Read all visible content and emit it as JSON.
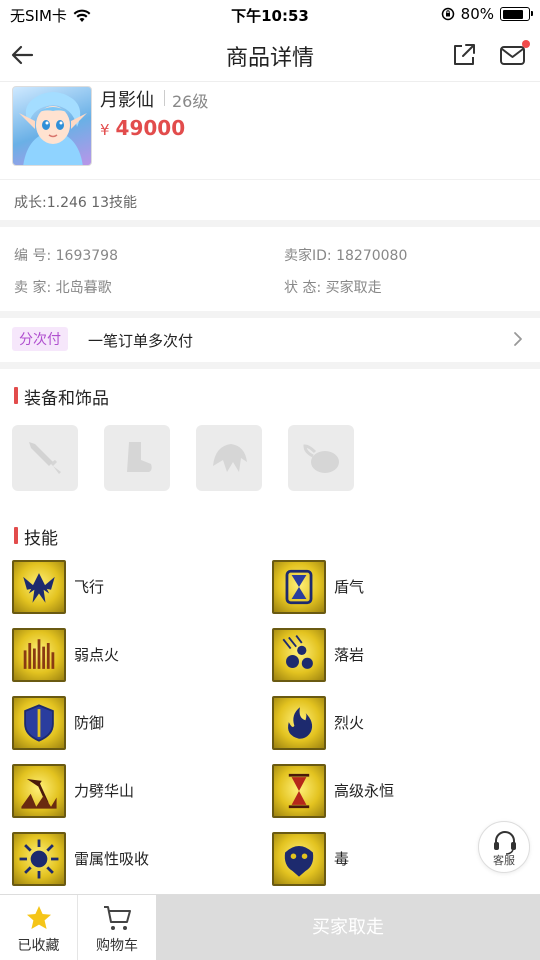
{
  "status_bar": {
    "carrier": "无SIM卡",
    "time": "下午10:53",
    "battery": "80%"
  },
  "nav": {
    "title": "商品详情"
  },
  "product": {
    "name": "月影仙",
    "level": "26级",
    "currency": "¥",
    "price": "49000",
    "growth": "成长:1.246 13技能"
  },
  "info": {
    "id_label": "编 号:",
    "id_value": "1693798",
    "seller_id_label": "卖家ID:",
    "seller_id_value": "18270080",
    "seller_label": "卖 家:",
    "seller_value": "北岛暮歌",
    "state_label": "状 态:",
    "state_value": "买家取走"
  },
  "installment": {
    "tag": "分次付",
    "text": "一笔订单多次付"
  },
  "equipment": {
    "title": "装备和饰品",
    "slots": [
      "weapon-icon",
      "boot-icon",
      "helmet-icon",
      "pouch-icon"
    ]
  },
  "skills": {
    "title": "技能",
    "items": [
      {
        "label": "飞行",
        "icon": "eagle-icon"
      },
      {
        "label": "盾气",
        "icon": "hourglass-shield-icon"
      },
      {
        "label": "弱点火",
        "icon": "fire-weakness-icon"
      },
      {
        "label": "落岩",
        "icon": "falling-rocks-icon"
      },
      {
        "label": "防御",
        "icon": "shield-icon"
      },
      {
        "label": "烈火",
        "icon": "flame-icon"
      },
      {
        "label": "力劈华山",
        "icon": "axe-strike-icon"
      },
      {
        "label": "高级永恒",
        "icon": "hourglass-icon"
      },
      {
        "label": "雷属性吸收",
        "icon": "thunder-sun-icon"
      },
      {
        "label": "毒",
        "icon": "poison-snake-icon"
      }
    ]
  },
  "service": {
    "label": "客服"
  },
  "bottom": {
    "favorite_label": "已收藏",
    "cart_label": "购物车",
    "buy_label": "买家取走"
  },
  "colors": {
    "accent": "#e24c4c",
    "installment_tag": "#b04fcf",
    "favorite_star": "#f5c518",
    "disabled_button": "#dcdcdc"
  }
}
